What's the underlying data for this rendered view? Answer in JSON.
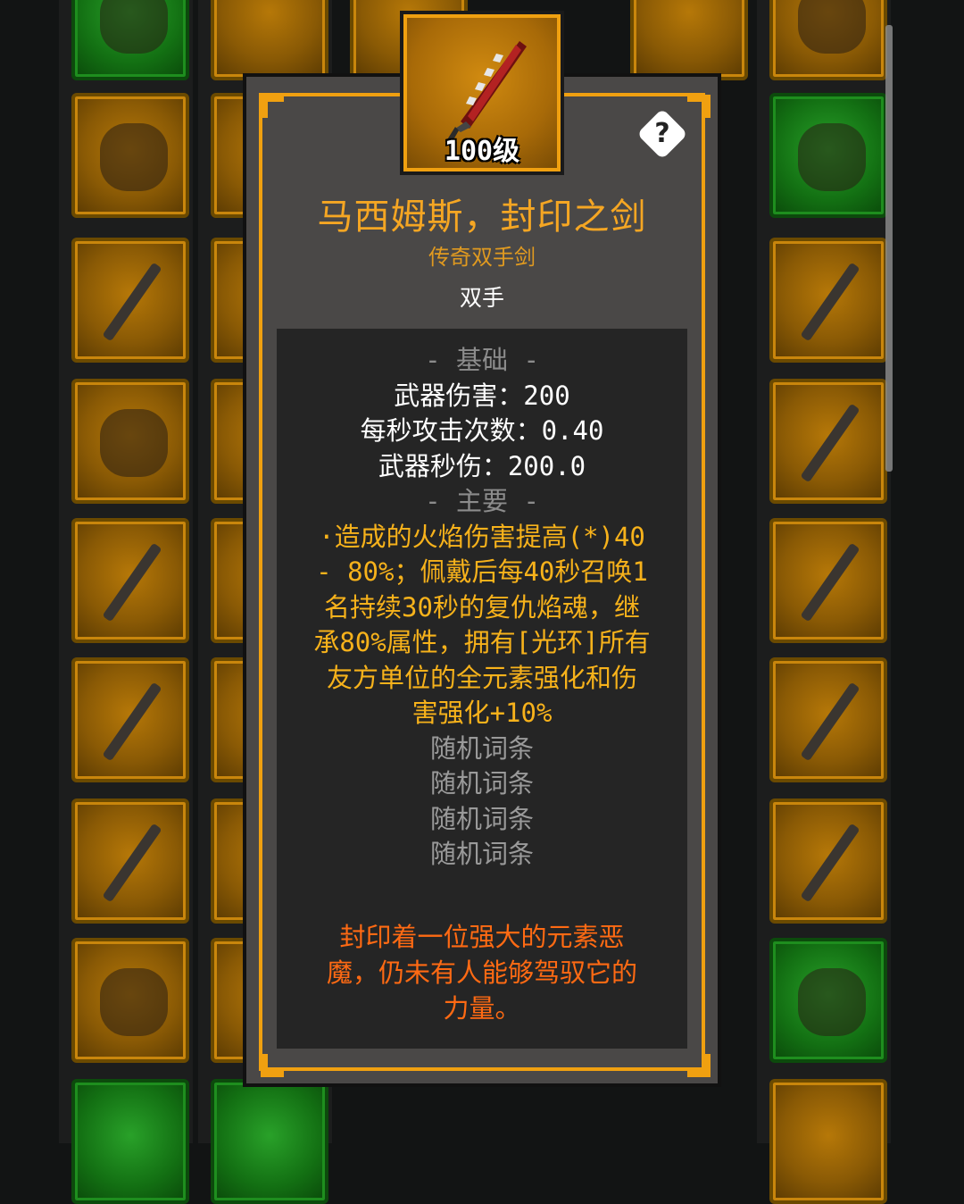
{
  "item": {
    "level_label": "100级",
    "help_icon_text": "?",
    "name": "马西姆斯，封印之剑",
    "type": "传奇双手剑",
    "hand": "双手"
  },
  "stats": {
    "basic_header": "- 基础 -",
    "basic": [
      "武器伤害：200",
      "每秒攻击次数：0.40",
      "武器秒伤：200.0"
    ],
    "primary_header": "- 主要 -",
    "primary_affix_lines": [
      "·造成的火焰伤害提高(*)40",
      "- 80%；佩戴后每40秒召唤1",
      "名持续30秒的复仇焰魂，继",
      "承80%属性，拥有[光环]所有",
      "友方单位的全元素强化和伤",
      "害强化+10%"
    ],
    "random_affixes": [
      "随机词条",
      "随机词条",
      "随机词条",
      "随机词条"
    ],
    "flavor_lines": [
      "封印着一位强大的元素恶",
      "魔，仍未有人能够驾驭它的",
      "力量。"
    ]
  },
  "colors": {
    "legendary_orange": "#f5a623",
    "affix_gold": "#f7b21b",
    "flavor_orange": "#ff6a13",
    "frame_orange": "#f0a010",
    "slot_green": "#1e8e1e"
  },
  "icons": {
    "item_icon": "sword-icon",
    "help": "help-icon"
  }
}
